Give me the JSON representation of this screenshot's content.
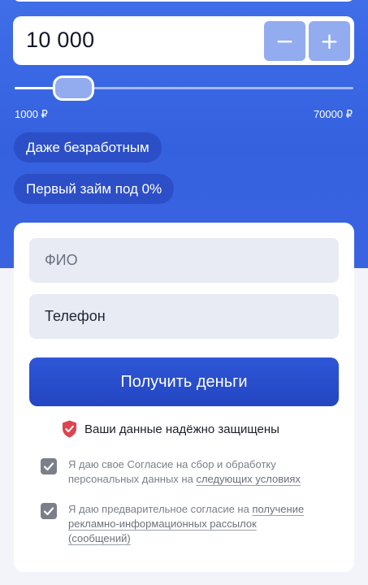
{
  "loan": {
    "amount_value": "10 000",
    "minus_label": "−",
    "plus_label": "+",
    "slider_fraction": 0.13,
    "range_min": "1000 ₽",
    "range_max": "70000 ₽"
  },
  "badges": [
    {
      "label": "Даже безработным"
    },
    {
      "label": "Первый займ под 0%"
    }
  ],
  "form": {
    "fio_placeholder": "ФИО",
    "phone_value": "Телефон",
    "submit_label": "Получить деньги",
    "secure_text": "Ваши данные надёжно защищены"
  },
  "consents": [
    {
      "checked": true,
      "text": "Я даю свое Согласие на сбор и обработку персональных данных на ",
      "link": "следующих условиях"
    },
    {
      "checked": true,
      "text": "Я даю предварительное согласие на ",
      "link": "получение рекламно-информационных рассылок (сообщений)"
    }
  ],
  "icons": {
    "shield": "shield-check-icon",
    "checkbox": "checkbox-checked-icon"
  },
  "colors": {
    "primary": "#2d56d6",
    "hero_bg": "#3a67e3",
    "accent_light": "#93acef",
    "shield_red": "#e0424f"
  }
}
